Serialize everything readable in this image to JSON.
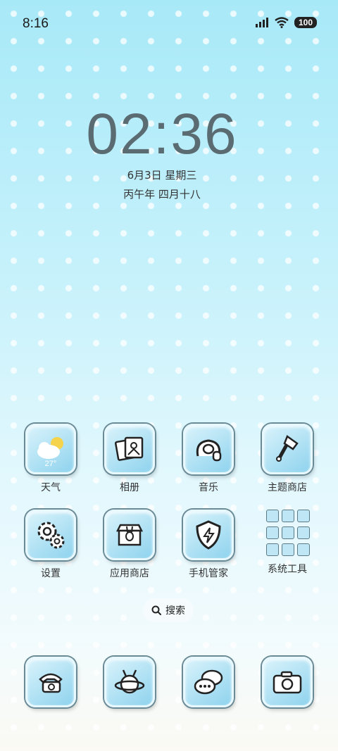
{
  "status_bar": {
    "time": "8:16",
    "battery": "100"
  },
  "clock": {
    "time": "02:36",
    "date": "6月3日 星期三",
    "lunar": "丙午年 四月十八"
  },
  "weather_temp": "27°",
  "apps_row1": [
    {
      "label": "天气",
      "icon": "weather-icon"
    },
    {
      "label": "相册",
      "icon": "photo-album-icon"
    },
    {
      "label": "音乐",
      "icon": "headphones-icon"
    },
    {
      "label": "主题商店",
      "icon": "paintbrush-icon"
    }
  ],
  "apps_row2": [
    {
      "label": "设置",
      "icon": "gear-icon"
    },
    {
      "label": "应用商店",
      "icon": "shop-icon"
    },
    {
      "label": "手机管家",
      "icon": "shield-icon"
    },
    {
      "label": "系统工具",
      "icon": "folder-icon"
    }
  ],
  "search": {
    "label": "搜索"
  },
  "dock": [
    {
      "icon": "phone-icon"
    },
    {
      "icon": "browser-icon"
    },
    {
      "icon": "messages-icon"
    },
    {
      "icon": "camera-icon"
    }
  ]
}
